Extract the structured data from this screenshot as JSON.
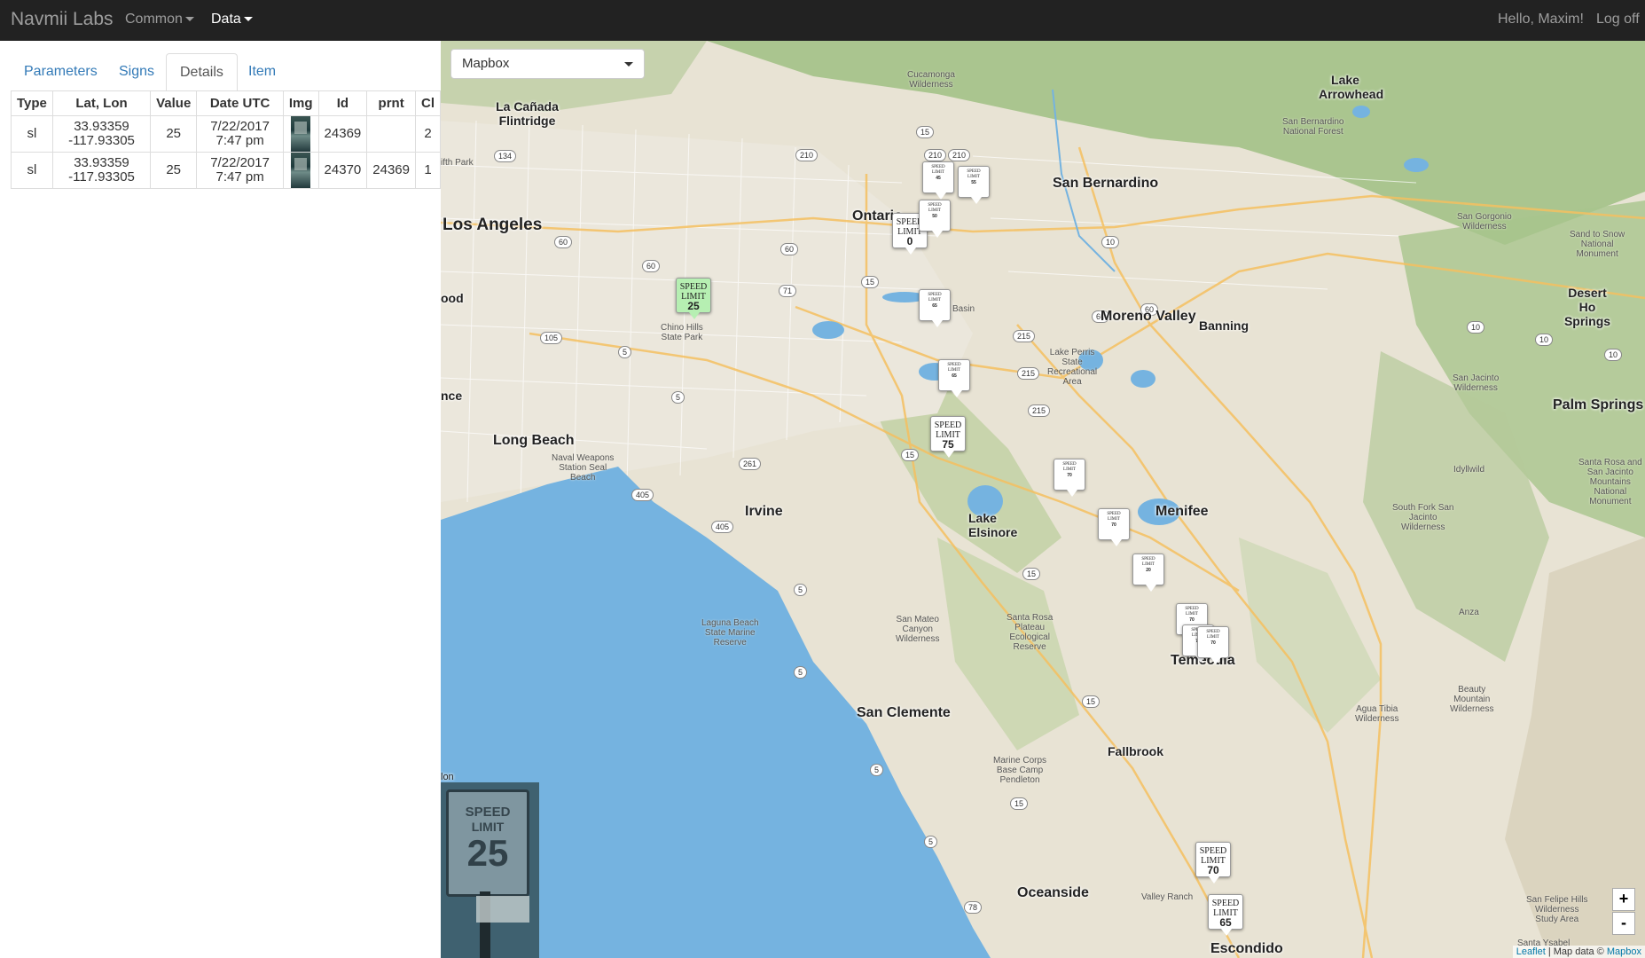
{
  "navbar": {
    "brand": "Navmii Labs",
    "menus": [
      {
        "label": "Common",
        "active": false
      },
      {
        "label": "Data",
        "active": true
      }
    ],
    "greeting": "Hello, Maxim!",
    "logoff": "Log off"
  },
  "tabs": [
    "Parameters",
    "Signs",
    "Details",
    "Item"
  ],
  "active_tab": "Details",
  "table": {
    "headers": [
      "Type",
      "Lat, Lon",
      "Value",
      "Date UTC",
      "Img",
      "Id",
      "prnt",
      "Cl"
    ],
    "rows": [
      {
        "type": "sl",
        "lat": "33.93359",
        "lon": "-117.93305",
        "value": "25",
        "date": "7/22/2017",
        "time": "7:47 pm",
        "id": "24369",
        "prnt": "",
        "cl": "2"
      },
      {
        "type": "sl",
        "lat": "33.93359",
        "lon": "-117.93305",
        "value": "25",
        "date": "7/22/2017",
        "time": "7:47 pm",
        "id": "24370",
        "prnt": "24369",
        "cl": "1"
      }
    ]
  },
  "map": {
    "basemap": "Mapbox",
    "zoom_in": "+",
    "zoom_out": "-",
    "attribution": {
      "leaflet": "Leaflet",
      "sep": " | Map data © ",
      "mapbox": "Mapbox"
    },
    "cities": {
      "los_angeles": "Los Angeles",
      "ontario": "Ontario",
      "san_bernardino": "San Bernardino",
      "moreno_valley": "Moreno Valley",
      "long_beach": "Long Beach",
      "irvine": "Irvine",
      "menifee": "Menifee",
      "temecula": "Temecula",
      "san_clemente": "San Clemente",
      "oceanside": "Oceanside",
      "escondido": "Escondido",
      "banning": "Banning",
      "palm_springs": "Palm Springs",
      "la_canada": "La Cañada Flintridge",
      "lake_arrowhead": "Lake Arrowhead",
      "fallbrook": "Fallbrook",
      "lake_elsinore": "Lake Elsinore",
      "desert_hot": "Desert Ho Springs"
    },
    "regions": {
      "cucamonga": "Cucamonga\nWilderness",
      "sbnf": "San Bernardino\nNational Forest",
      "sangorgonio": "San Gorgonio\nWilderness",
      "sandtosnow": "Sand to Snow\nNational\nMonument",
      "chino": "Chino Hills\nState Park",
      "perris": "Lake Perris\nState\nRecreational\nArea",
      "sanjacinto": "San Jacinto\nWilderness",
      "idyllwild": "Idyllwild",
      "santarosa": "Santa Rosa and\nSan Jacinto\nMountains\nNational\nMonument",
      "southfork": "South Fork San\nJacinto\nWilderness",
      "sealbeach": "Naval Weapons\nStation Seal\nBeach",
      "laguna": "Laguna Beach\nState Marine\nReserve",
      "sanmateo": "San Mateo\nCanyon\nWilderness",
      "santarosaplateau": "Santa Rosa\nPlateau\nEcological\nReserve",
      "anza": "Anza",
      "beauty": "Beauty\nMountain\nWilderness",
      "agua": "Agua Tibia\nWilderness",
      "pendleton": "Marine Corps\nBase Camp\nPendleton",
      "sanfelipe": "San Felipe Hills\nWilderness\nStudy Area",
      "oldpark": "ifth Park",
      "ynez": "Santa Ysabel",
      "valley": "Valley Ranch",
      "ood": "ood",
      "nce": "nce",
      "lon": "lon",
      "basin": "Basin"
    },
    "markers": [
      {
        "l1": "SPEED",
        "l2": "LIMIT",
        "v": "25",
        "kind": "green"
      },
      {
        "l1": "SPEED",
        "l2": "LIMIT",
        "v": "0",
        "kind": "normal"
      },
      {
        "l1": "SPEED",
        "l2": "LIMIT",
        "v": "75",
        "kind": "normal"
      },
      {
        "l1": "SPEED",
        "l2": "LIMIT",
        "v": "70",
        "kind": "normal"
      },
      {
        "l1": "SPEED",
        "l2": "LIMIT",
        "v": "65",
        "kind": "normal"
      },
      {
        "l1": "SPEED",
        "l2": "LIMIT",
        "v": "45",
        "kind": "small"
      },
      {
        "l1": "SPEED",
        "l2": "LIMIT",
        "v": "55",
        "kind": "small"
      },
      {
        "l1": "SPEED",
        "l2": "LIMIT",
        "v": "50",
        "kind": "small"
      },
      {
        "l1": "SPEED",
        "l2": "LIMIT",
        "v": "65",
        "kind": "small"
      },
      {
        "l1": "SPEED",
        "l2": "LIMIT",
        "v": "65",
        "kind": "small"
      },
      {
        "l1": "SPEED",
        "l2": "LIMIT",
        "v": "70",
        "kind": "small"
      },
      {
        "l1": "SPEED",
        "l2": "LIMIT",
        "v": "70",
        "kind": "small"
      },
      {
        "l1": "SPEED",
        "l2": "LIMIT",
        "v": "20",
        "kind": "small"
      },
      {
        "l1": "SPEED",
        "l2": "LIMIT",
        "v": "70",
        "kind": "small"
      },
      {
        "l1": "SPEED",
        "l2": "LIMIT",
        "v": "70",
        "kind": "small"
      },
      {
        "l1": "SPEED",
        "l2": "LIMIT",
        "v": "70",
        "kind": "small"
      }
    ],
    "shields": [
      "210",
      "210",
      "210",
      "134",
      "15",
      "60",
      "60",
      "60",
      "10",
      "10",
      "10",
      "10",
      "60",
      "60",
      "71",
      "15",
      "215",
      "215",
      "215",
      "105",
      "5",
      "5",
      "5",
      "5",
      "5",
      "5",
      "405",
      "405",
      "261",
      "15",
      "15",
      "15",
      "15",
      "78"
    ],
    "preview": {
      "l1": "SPEED",
      "l2": "LIMIT",
      "v": "25"
    }
  },
  "colors": {
    "navbar": "#222222",
    "link": "#337ab7",
    "water": "#75b3e0",
    "green_marker": "#b6efb2"
  }
}
